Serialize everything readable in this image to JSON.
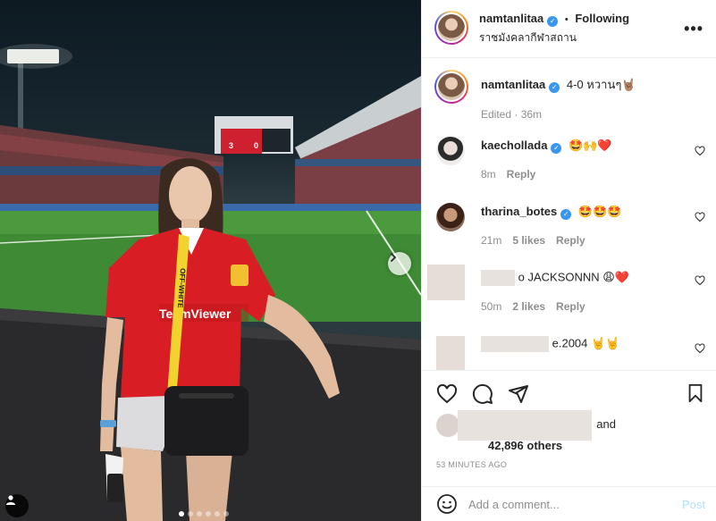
{
  "post_header": {
    "username": "namtanlitaa",
    "separator": "•",
    "follow_status": "Following",
    "location": "ราชมังคลากีฬาสถาน",
    "more_icon": "more-horizontal-icon"
  },
  "caption": {
    "username": "namtanlitaa",
    "text": "4-0 หวานๆ🤘🏽",
    "edited": "Edited · 36m"
  },
  "comments": [
    {
      "username": "kaechollada",
      "text": "🤩🙌❤️",
      "time": "8m",
      "likes": "",
      "reply": "Reply"
    },
    {
      "username": "tharina_botes",
      "text": "🤩🤩🤩",
      "time": "21m",
      "likes": "5 likes",
      "reply": "Reply"
    },
    {
      "username": "",
      "text": "o JACKSONNN 😩❤️",
      "time": "50m",
      "likes": "2 likes",
      "reply": "Reply"
    },
    {
      "username": "",
      "text": "e.2004 🤘🤘",
      "time": "",
      "likes": "",
      "reply": ""
    }
  ],
  "likes": {
    "suffix": "and",
    "others": "42,896 others"
  },
  "timestamp": "53 MINUTES AGO",
  "add_comment": {
    "placeholder": "Add a comment...",
    "post_label": "Post"
  },
  "photo": {
    "scoreboard_left": "3",
    "scoreboard_right": "0",
    "sponsor_text": "TeamViewer",
    "strap_text": "OFF-WHITE",
    "carousel_count": 6,
    "carousel_active": 1
  },
  "colors": {
    "verified": "#3897f0",
    "post_button": "#b2dffc",
    "jersey_red": "#d81e24",
    "strap_yellow": "#f2d22e"
  }
}
